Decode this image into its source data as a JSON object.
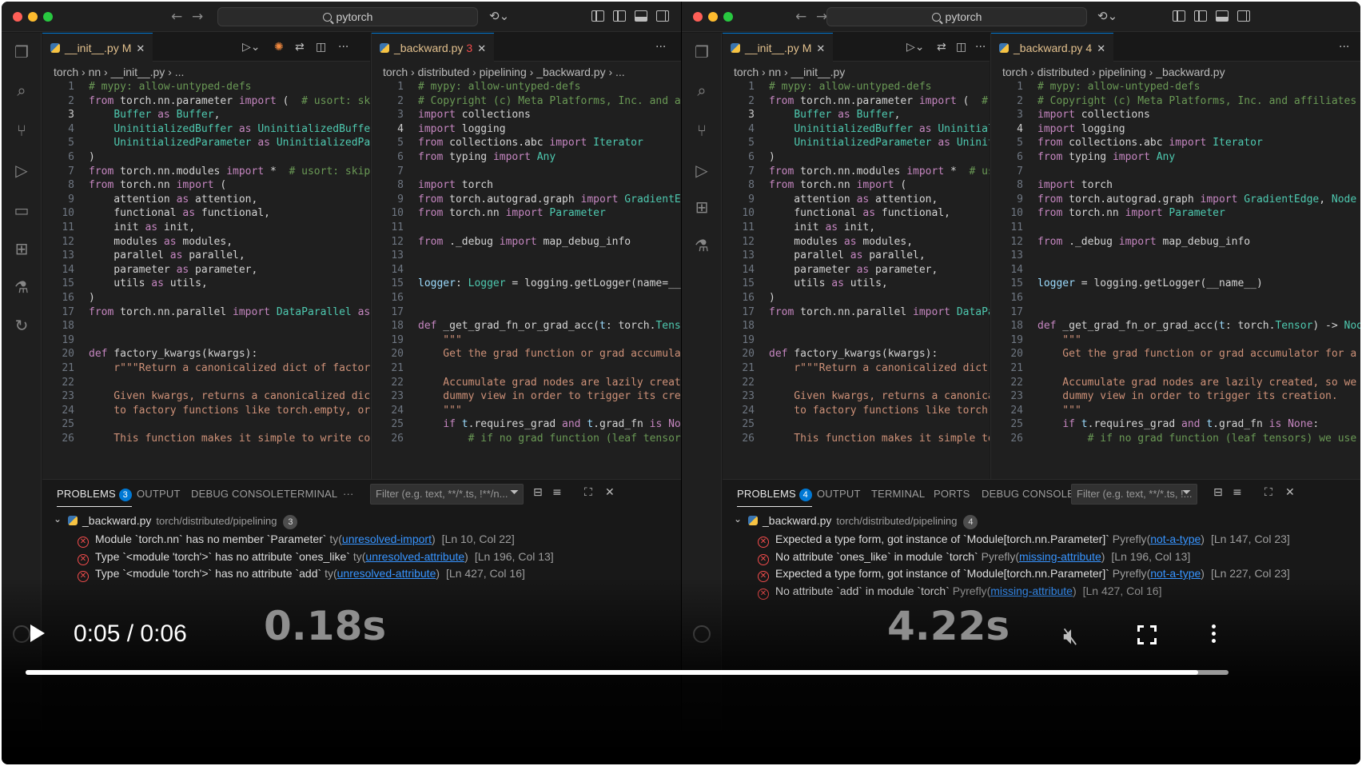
{
  "search_text": "pytorch",
  "left": {
    "tab1": {
      "name": "__init__.py",
      "status": "M"
    },
    "tab2": {
      "name": "_backward.py",
      "count": "3"
    },
    "crumbs_left": "torch  ›  nn  ›  __init__.py  ›  ...",
    "crumbs_right": "torch  ›  distributed  ›  pipelining  ›  _backward.py  ›  ...",
    "panel_tabs": [
      "PROBLEMS",
      "OUTPUT",
      "DEBUG CONSOLE",
      "TERMINAL",
      "···"
    ],
    "problems_badge": "3",
    "filter_placeholder": "Filter (e.g. text, **/*.ts, !**/n...",
    "file": "_backward.py",
    "dir": "torch/distributed/pipelining",
    "file_count": "3",
    "problems": [
      {
        "msg": "Module `torch.nn` has no member `Parameter`",
        "src": "ty",
        "rule": "unresolved-import",
        "loc": "[Ln 10, Col 22]"
      },
      {
        "msg": "Type `<module 'torch'>` has no attribute `ones_like`",
        "src": "ty",
        "rule": "unresolved-attribute",
        "loc": "[Ln 196, Col 13]"
      },
      {
        "msg": "Type `<module 'torch'>` has no attribute `add`",
        "src": "ty",
        "rule": "unresolved-attribute",
        "loc": "[Ln 427, Col 16]"
      }
    ]
  },
  "right": {
    "tab1": {
      "name": "__init__.py",
      "status": "M"
    },
    "tab2": {
      "name": "_backward.py",
      "count": "4"
    },
    "crumbs_left": "torch  ›  nn  ›  __init__.py",
    "crumbs_right": "torch  ›  distributed  ›  pipelining  ›  _backward.py",
    "panel_tabs": [
      "PROBLEMS",
      "OUTPUT",
      "TERMINAL",
      "PORTS",
      "DEBUG CONSOLE"
    ],
    "problems_badge": "4",
    "filter_placeholder": "Filter (e.g. text, **/*.ts, !...",
    "file": "_backward.py",
    "dir": "torch/distributed/pipelining",
    "file_count": "4",
    "problems": [
      {
        "msg": "Expected a type form, got instance of `Module[torch.nn.Parameter]`",
        "src": "Pyrefly",
        "rule": "not-a-type",
        "loc": "[Ln 147, Col 23]"
      },
      {
        "msg": "No attribute `ones_like` in module `torch`",
        "src": "Pyrefly",
        "rule": "missing-attribute",
        "loc": "[Ln 196, Col 13]"
      },
      {
        "msg": "Expected a type form, got instance of `Module[torch.nn.Parameter]`",
        "src": "Pyrefly",
        "rule": "not-a-type",
        "loc": "[Ln 227, Col 23]"
      },
      {
        "msg": "No attribute `add` in module `torch`",
        "src": "Pyrefly",
        "rule": "missing-attribute",
        "loc": "[Ln 427, Col 16]"
      }
    ]
  },
  "init_code": [
    "# mypy: allow-untyped-defs",
    "from torch.nn.parameter import (  # usort: skip",
    "    Buffer as Buffer,",
    "    UninitializedBuffer as UninitializedBuffer,",
    "    UninitializedParameter as UninitializedParameter,",
    ")",
    "from torch.nn.modules import *  # usort: skip",
    "from torch.nn import (",
    "    attention as attention,",
    "    functional as functional,",
    "    init as init,",
    "    modules as modules,",
    "    parallel as parallel,",
    "    parameter as parameter,",
    "    utils as utils,",
    ")",
    "from torch.nn.parallel import DataParallel as DataParallel",
    "",
    "",
    "def factory_kwargs(kwargs):",
    "    r\"\"\"Return a canonicalized dict of factory kwargs.",
    "",
    "    Given kwargs, returns a canonicalized dict of factory kwargs that can be directly passed",
    "    to factory functions like torch.empty, or errors if unrecognized kwargs are present.",
    "",
    "    This function makes it simple to write code like this::"
  ],
  "backward_code_left": [
    "# mypy: allow-untyped-defs",
    "# Copyright (c) Meta Platforms, Inc. and affiliates",
    "import collections",
    "import logging",
    "from collections.abc import Iterator",
    "from typing import Any",
    "",
    "import torch",
    "from torch.autograd.graph import GradientEdge, Node",
    "from torch.nn import Parameter",
    "",
    "from ._debug import map_debug_info",
    "",
    "",
    "logger: Logger = logging.getLogger(name=__name__)",
    "",
    "",
    "def _get_grad_fn_or_grad_acc(t: torch.Tensor) -> Node | None:",
    "    \"\"\"",
    "    Get the grad function or grad accumulator for a tensor.",
    "",
    "    Accumulate grad nodes are lazily created, so we need to",
    "    dummy view in order to trigger its creation.",
    "    \"\"\"",
    "    if t.requires_grad and t.grad_fn is None:",
    "        # if no grad function (leaf tensors) we use view"
  ],
  "backward_code_right": [
    "# mypy: allow-untyped-defs",
    "# Copyright (c) Meta Platforms, Inc. and affiliates",
    "import collections",
    "import logging",
    "from collections.abc import Iterator",
    "from typing import Any",
    "",
    "import torch",
    "from torch.autograd.graph import GradientEdge, Node",
    "from torch.nn import Parameter",
    "",
    "from ._debug import map_debug_info",
    "",
    "",
    "logger = logging.getLogger(__name__)",
    "",
    "",
    "def _get_grad_fn_or_grad_acc(t: torch.Tensor) -> Node | None:",
    "    \"\"\"",
    "    Get the grad function or grad accumulator for a tensor.",
    "",
    "    Accumulate grad nodes are lazily created, so we need to",
    "    dummy view in order to trigger its creation.",
    "    \"\"\"",
    "    if t.requires_grad and t.grad_fn is None:",
    "        # if no grad function (leaf tensors) we use view"
  ],
  "video": {
    "time": "0:05 / 0:06",
    "left_label": "0.18s",
    "right_label": "4.22s",
    "progress": 0.975
  }
}
